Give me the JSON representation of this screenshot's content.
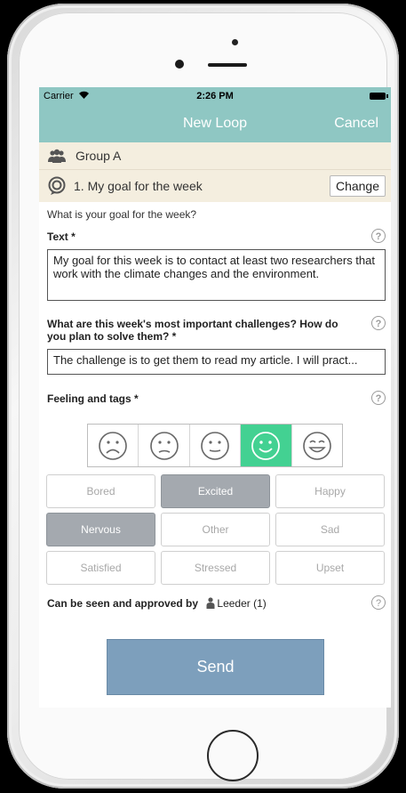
{
  "status_bar": {
    "carrier": "Carrier",
    "wifi_icon": "wifi-icon",
    "time": "2:26 PM",
    "battery_icon": "battery-icon"
  },
  "nav": {
    "title": "New Loop",
    "cancel_label": "Cancel"
  },
  "group": {
    "icon": "group-icon",
    "name": "Group A"
  },
  "goal": {
    "icon": "target-icon",
    "title": "1. My goal for the week",
    "change_label": "Change"
  },
  "form": {
    "question": "What is your goal for the week?",
    "text_label": "Text *",
    "text_value": "My goal for this week is to contact at least two researchers that work with the climate changes and the environment.",
    "challenges_label": "What are this week's most important challenges? How do you plan to solve them? *",
    "challenges_value": "The challenge is to get them to read my article. I will pract...",
    "feeling_label": "Feeling and tags *",
    "help_glyph": "?"
  },
  "feelings": {
    "options": [
      "very-sad-face-icon",
      "sad-face-icon",
      "neutral-face-icon",
      "happy-face-icon",
      "very-happy-face-icon"
    ],
    "selected_index": 3,
    "selected_color": "#43d192"
  },
  "tags": {
    "items": [
      {
        "label": "Bored",
        "selected": false
      },
      {
        "label": "Excited",
        "selected": true
      },
      {
        "label": "Happy",
        "selected": false
      },
      {
        "label": "Nervous",
        "selected": true
      },
      {
        "label": "Other",
        "selected": false
      },
      {
        "label": "Sad",
        "selected": false
      },
      {
        "label": "Satisfied",
        "selected": false
      },
      {
        "label": "Stressed",
        "selected": false
      },
      {
        "label": "Upset",
        "selected": false
      }
    ]
  },
  "approval": {
    "label": "Can be seen and approved by",
    "person_icon": "person-icon",
    "approver": "Leeder (1)"
  },
  "send_label": "Send",
  "colors": {
    "header": "#8fc7c3",
    "group_bg": "#f4eedf",
    "send_button": "#7d9fbc",
    "selected_tag": "#a4a9af"
  }
}
